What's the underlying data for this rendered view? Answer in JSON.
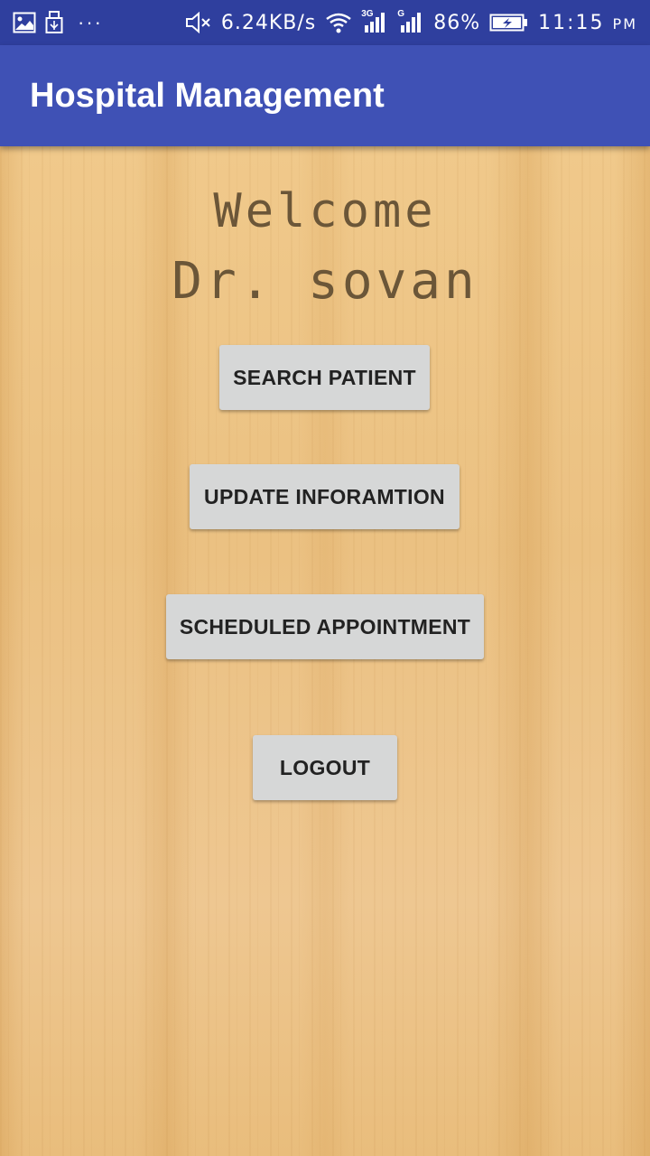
{
  "status_bar": {
    "left_icons": [
      "image-icon",
      "usb-icon",
      "more-dots-icon"
    ],
    "mute_icon": "volume-mute-icon",
    "network_speed": "6.24KB/s",
    "wifi_icon": "wifi-icon",
    "signal1_label": "3G",
    "signal2_label": "G",
    "battery_percent": "86%",
    "battery_icon": "battery-charging-icon",
    "time": "11:15",
    "ampm": "PM"
  },
  "app_bar": {
    "title": "Hospital Management",
    "color": "#3f51b5"
  },
  "main": {
    "welcome_line1": "Welcome",
    "welcome_line2": "Dr. sovan",
    "buttons": {
      "search_patient": "SEARCH PATIENT",
      "update_information": "UPDATE INFORAMTION",
      "scheduled_appointment": "SCHEDULED APPOINTMENT",
      "logout": "LOGOUT"
    }
  },
  "colors": {
    "status_bar": "#2f3f9e",
    "wood_background": "#ecc488",
    "welcome_text": "#6b5638",
    "button_bg": "#d6d7d7"
  }
}
